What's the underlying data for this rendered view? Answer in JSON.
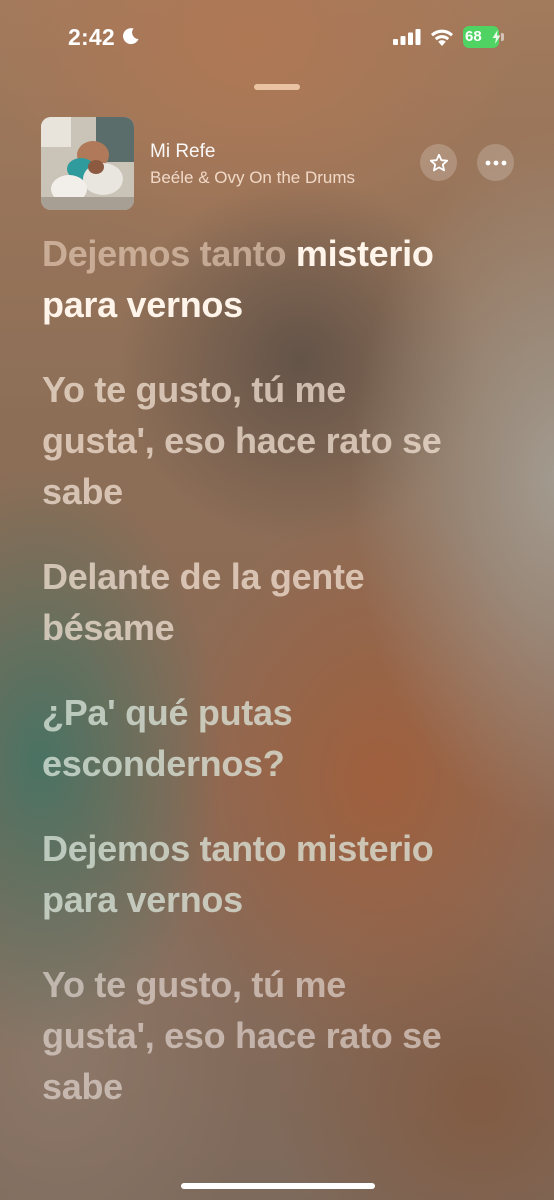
{
  "status_bar": {
    "time": "2:42",
    "battery_level": "68",
    "icons": [
      "moon-icon",
      "signal-icon",
      "wifi-icon",
      "battery-icon",
      "bolt-icon"
    ]
  },
  "now_playing": {
    "title": "Mi Refe",
    "artist": "Beéle & Ovy On the Drums",
    "artwork": "album-artwork",
    "actions": [
      "star-icon",
      "ellipsis-icon"
    ]
  },
  "lyrics": {
    "current_line": {
      "sung": "Dejemos tanto",
      "upcoming": "misterio para vernos"
    },
    "lines": [
      "Yo te gusto, tú me gusta', eso hace rato se sabe",
      "Delante de la gente bésame",
      "¿Pa' qué putas escondernos?",
      "Dejemos tanto misterio para vernos",
      "Yo te gusto, tú me gusta', eso hace rato se sabe"
    ]
  },
  "colors": {
    "active_lyric": "#fff4ea",
    "battery_green": "#4fd363",
    "accent_text": "#ffffff"
  }
}
